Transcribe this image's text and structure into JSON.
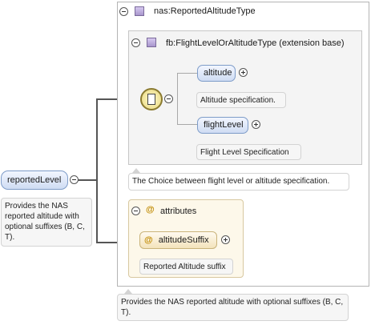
{
  "root": {
    "element_label": "reportedLevel",
    "documentation": "Provides the NAS reported altitude with optional suffixes (B, C, T)."
  },
  "type_box": {
    "title": "nas:ReportedAltitudeType",
    "documentation": "Provides the NAS reported altitude with optional suffixes (B, C, T)."
  },
  "base_box": {
    "title": "fb:FlightLevelOrAltitudeType (extension base)"
  },
  "choice": {
    "documentation": "The Choice between flight level or altitude specification.",
    "items": [
      {
        "label": "altitude",
        "documentation": "Altitude specification."
      },
      {
        "label": "flightLevel",
        "documentation": "Flight Level Specification"
      }
    ]
  },
  "attributes": {
    "title": "attributes",
    "item_label": "altitudeSuffix",
    "item_documentation": "Reported Altitude suffix"
  },
  "icons": {
    "collapse": "collapse-minus-icon",
    "expand": "expand-plus-icon",
    "type": "complex-type-icon",
    "choice": "choice-compositor-icon",
    "attribute": "attribute-at-icon"
  },
  "colors": {
    "element_node": "#cfdcf3",
    "attribute_panel": "#fdf8ea",
    "choice": "#e8d880"
  }
}
